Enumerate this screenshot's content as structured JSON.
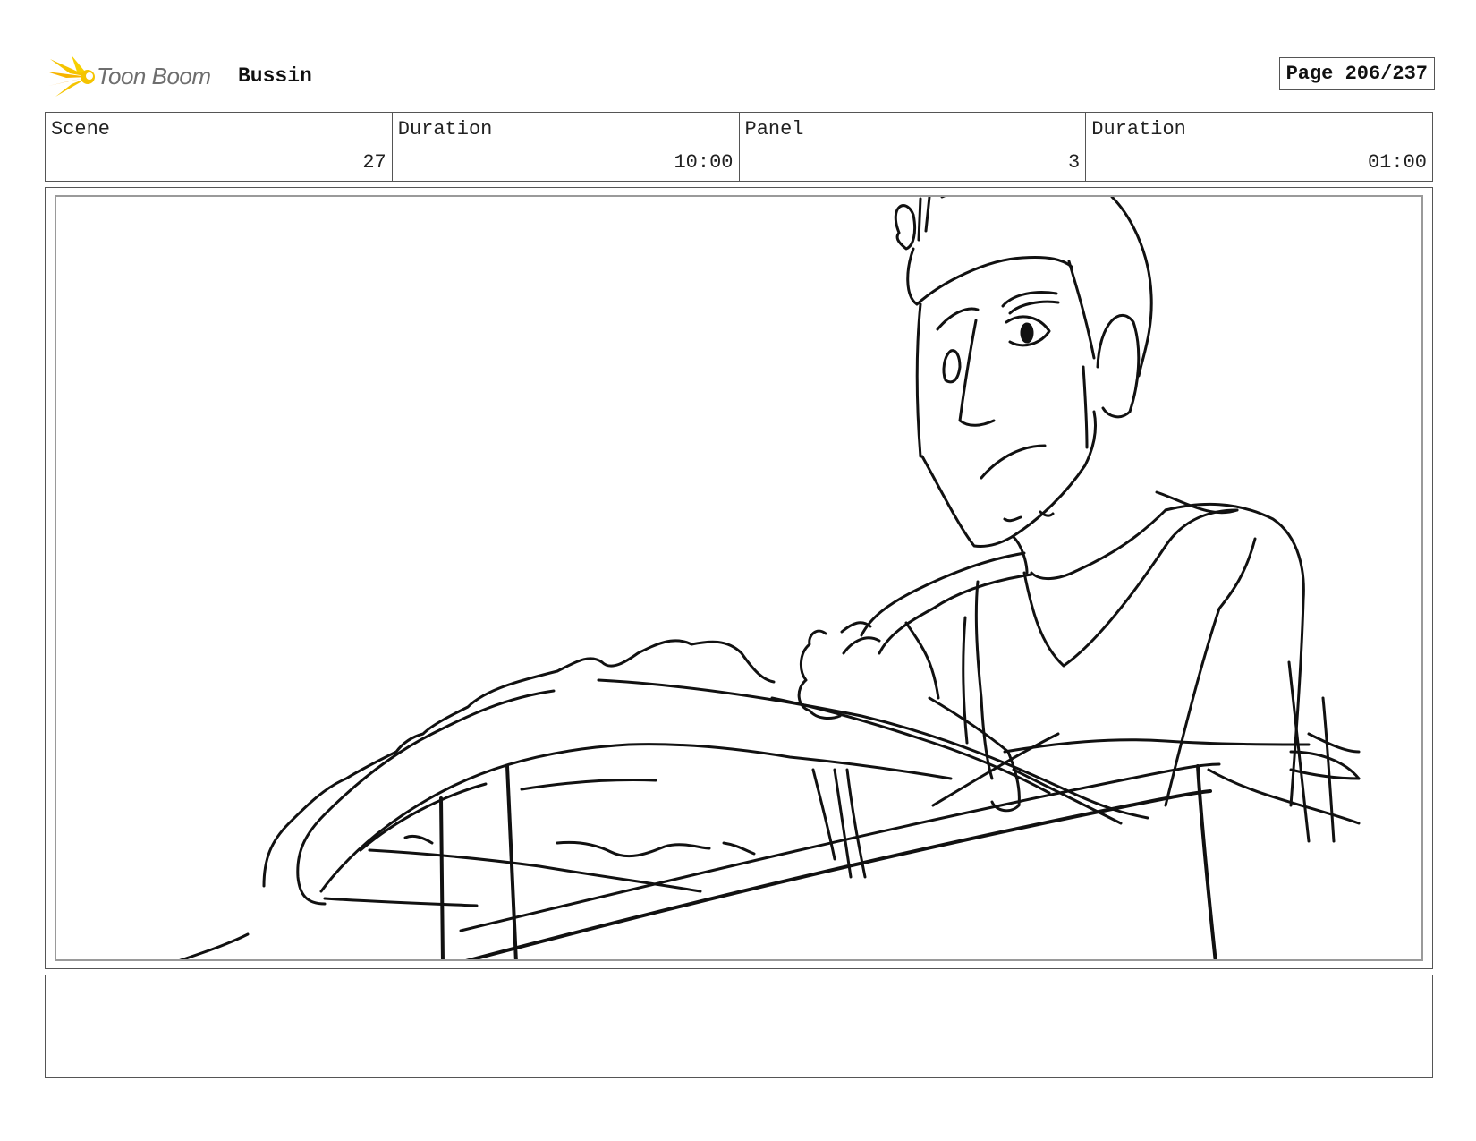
{
  "header": {
    "logo_text": "Toon Boom",
    "logo_icon": "toon-boom-burst-icon",
    "project_title": "Bussin",
    "page_label": "Page 206/237"
  },
  "info": {
    "scene_label": "Scene",
    "scene_value": "27",
    "scene_duration_label": "Duration",
    "scene_duration_value": "10:00",
    "panel_label": "Panel",
    "panel_value": "3",
    "panel_duration_label": "Duration",
    "panel_duration_value": "01:00"
  },
  "notes": {
    "text": ""
  },
  "colors": {
    "logo_yellow": "#F5C400",
    "logo_orange": "#F39A00",
    "border": "#555555",
    "sketch": "#111111"
  }
}
